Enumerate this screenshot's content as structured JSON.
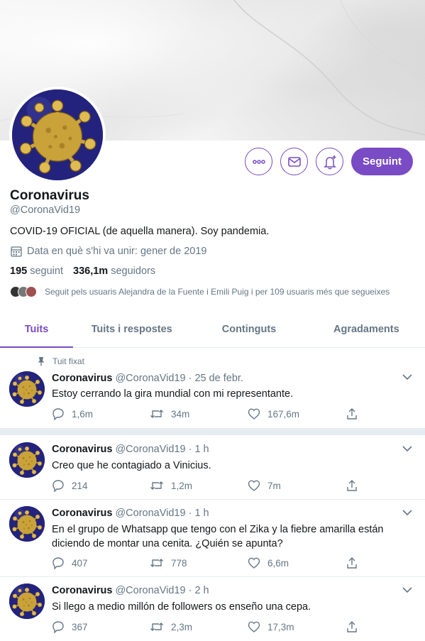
{
  "profile": {
    "name": "Coronavirus",
    "handle": "@CoronaVid19",
    "bio": "COVID-19 OFICIAL (de aquella manera). Soy pandemia.",
    "joined": "Data en què s'hi va unir: gener de 2019",
    "following_count": "195",
    "following_label": "seguint",
    "followers_count": "336,1m",
    "followers_label": "seguidors",
    "followed_by": "Seguit pels usuaris Alejandra de la Fuente i Emili Puig i per 109 usuaris més que segueixes"
  },
  "actions": {
    "more_icon": "more-icon",
    "message_icon": "envelope-icon",
    "notify_icon": "bell-plus-icon",
    "follow_label": "Seguint"
  },
  "tabs": [
    {
      "label": "Tuits",
      "active": true
    },
    {
      "label": "Tuits i respostes",
      "active": false
    },
    {
      "label": "Continguts",
      "active": false
    },
    {
      "label": "Agradaments",
      "active": false
    }
  ],
  "pinned_label": "Tuit fixat",
  "tweets": [
    {
      "name": "Coronavirus",
      "meta": "@CoronaVid19 · 25 de febr.",
      "text": "Estoy cerrando la gira mundial con mi representante.",
      "replies": "1,6m",
      "retweets": "34m",
      "likes": "167,6m"
    },
    {
      "name": "Coronavirus",
      "meta": "@CoronaVid19 · 1 h",
      "text": "Creo que he contagiado a Vinicius.",
      "replies": "214",
      "retweets": "1,2m",
      "likes": "7m"
    },
    {
      "name": "Coronavirus",
      "meta": "@CoronaVid19 · 1 h",
      "text": "En el grupo de Whatsapp que tengo con el Zika y la fiebre amarilla están diciendo de montar una cenita. ¿Quién se apunta?",
      "replies": "407",
      "retweets": "778",
      "likes": "6,6m"
    },
    {
      "name": "Coronavirus",
      "meta": "@CoronaVid19 · 2 h",
      "text": "Si llego a medio millón de followers os enseño una cepa.",
      "replies": "367",
      "retweets": "2,3m",
      "likes": "17,3m"
    }
  ],
  "colors": {
    "accent": "#794bc4",
    "muted": "#657786",
    "text": "#14171a",
    "virus_bg": "#2a2a8a",
    "virus_body": "#c9a23a"
  }
}
